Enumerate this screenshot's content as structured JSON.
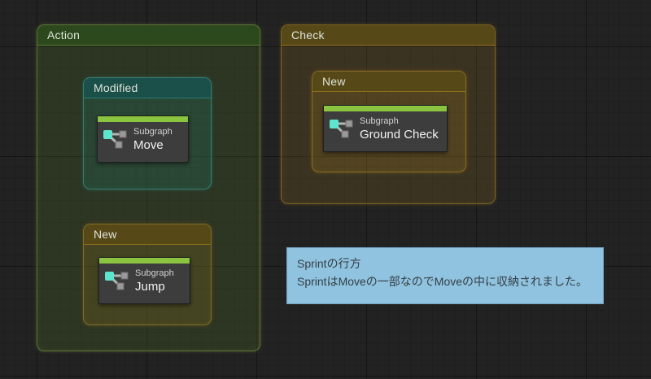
{
  "groups": {
    "action": {
      "label": "Action",
      "color": "#2c491e"
    },
    "modified": {
      "label": "Modified",
      "color": "#1b4f49"
    },
    "new_in_action": {
      "label": "New",
      "color": "#574818"
    },
    "check": {
      "label": "Check",
      "color": "#574818"
    },
    "new_in_check": {
      "label": "New",
      "color": "#574818"
    }
  },
  "nodes": {
    "move": {
      "type_label": "Subgraph",
      "title": "Move"
    },
    "jump": {
      "type_label": "Subgraph",
      "title": "Jump"
    },
    "ground_check": {
      "type_label": "Subgraph",
      "title": "Ground Check"
    }
  },
  "annotation": {
    "line1": "Sprintの行方",
    "line2": "SprintはMoveの一部なのでMoveの中に収納されました。",
    "bg_color": "#8fc3df",
    "text_color": "#363e46"
  },
  "colors": {
    "canvas_bg": "#222222",
    "node_body": "#3d3d3d",
    "node_title_bar": "#8bc53f",
    "subgraph_icon_accent": "#5de6cd"
  }
}
